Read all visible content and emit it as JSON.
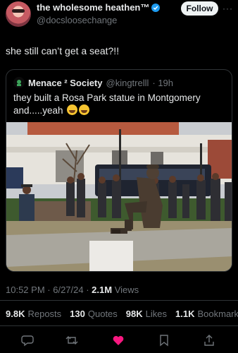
{
  "author": {
    "display_name": "the wholesome heathen™",
    "handle": "@docsloosechange",
    "follow_label": "Follow",
    "more_label": "···"
  },
  "tweet": {
    "text": "she still can’t get a seat?!!"
  },
  "quoted": {
    "display_name": "Menace ² Society",
    "handle": "@kingtrelll",
    "age": "· 19h",
    "text": "they built a Rosa Park statue in Montgomery and.....yeah"
  },
  "meta": {
    "time": "10:52 PM",
    "date": "· 6/27/24 ·",
    "views_count": "2.1M",
    "views_label": "Views"
  },
  "stats": {
    "reposts_count": "9.8K",
    "reposts_label": "Reposts",
    "quotes_count": "130",
    "quotes_label": "Quotes",
    "likes_count": "98K",
    "likes_label": "Likes",
    "bookmarks_count": "1.1K",
    "bookmarks_label": "Bookmarks"
  },
  "colors": {
    "accent": "#1d9bf0",
    "like": "#f91880",
    "muted": "#71767b",
    "border": "#2f3336"
  },
  "icons": [
    "reply-icon",
    "repost-icon",
    "like-icon",
    "bookmark-icon",
    "share-icon"
  ]
}
